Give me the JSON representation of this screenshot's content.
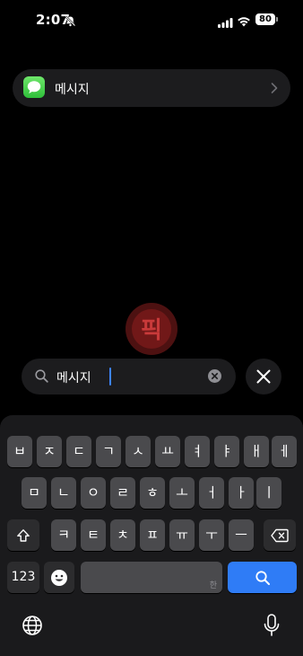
{
  "status_bar": {
    "time": "2:07",
    "battery": "80"
  },
  "result": {
    "app_name": "메시지"
  },
  "search": {
    "query": "메시지"
  },
  "watermark_text": "픽",
  "keyboard": {
    "row1": [
      "ㅂ",
      "ㅈ",
      "ㄷ",
      "ㄱ",
      "ㅅ",
      "ㅛ",
      "ㅕ",
      "ㅑ",
      "ㅐ",
      "ㅔ"
    ],
    "row2": [
      "ㅁ",
      "ㄴ",
      "ㅇ",
      "ㄹ",
      "ㅎ",
      "ㅗ",
      "ㅓ",
      "ㅏ",
      "ㅣ"
    ],
    "row3": [
      "ㅋ",
      "ㅌ",
      "ㅊ",
      "ㅍ",
      "ㅠ",
      "ㅜ",
      "ㅡ"
    ],
    "numbers_key": "123",
    "space_hint": "한"
  },
  "icons": [
    "bell-slash-icon",
    "signal-icon",
    "wifi-icon",
    "messages-app-icon",
    "chevron-right-icon",
    "search-icon",
    "clear-icon",
    "close-icon",
    "shift-icon",
    "delete-icon",
    "emoji-icon",
    "globe-icon",
    "microphone-icon"
  ]
}
